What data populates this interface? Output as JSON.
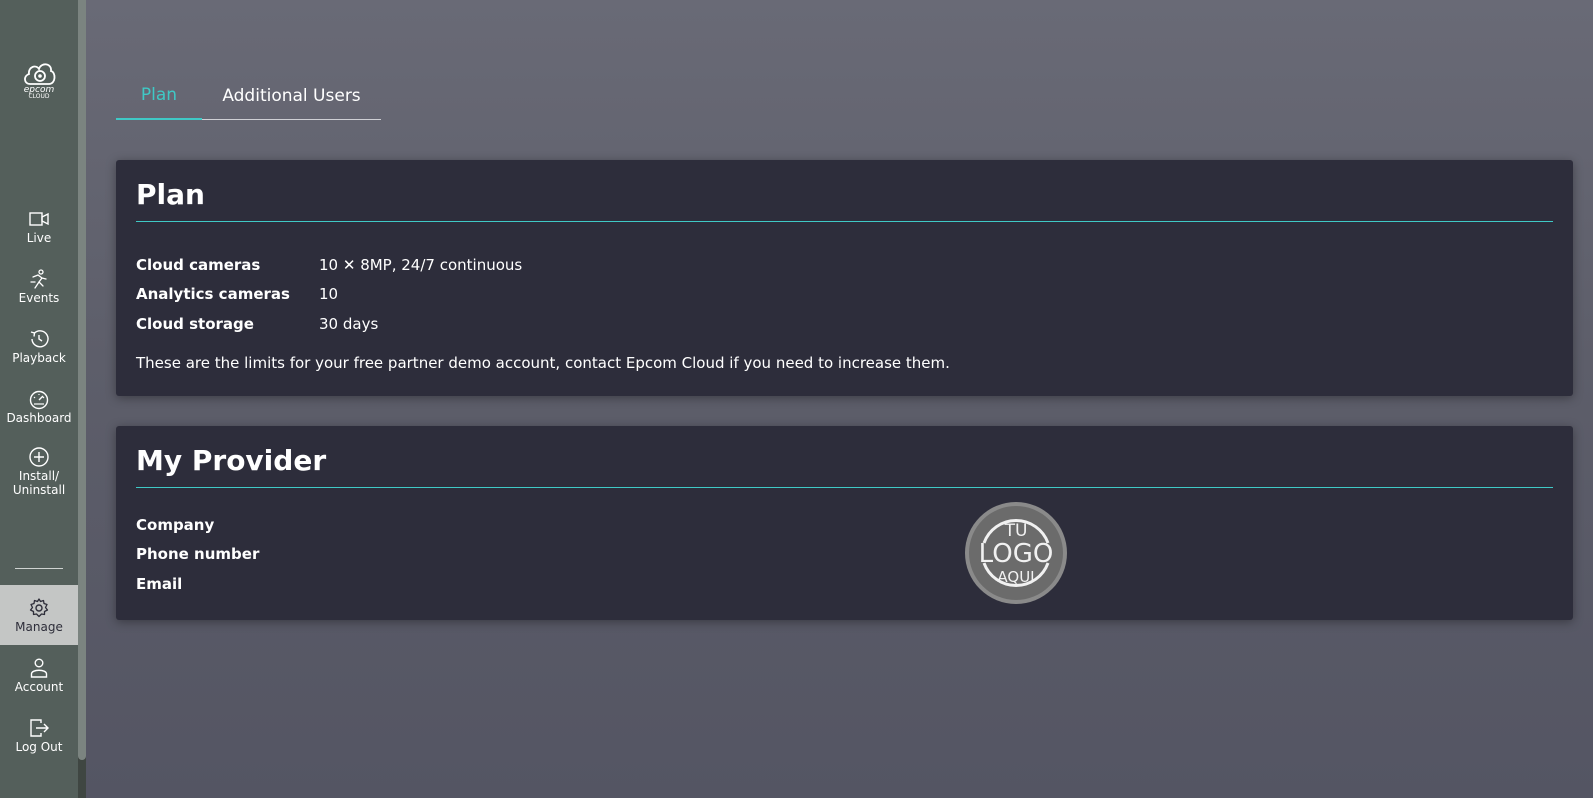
{
  "brand": {
    "name": "epcom",
    "sub": "CLOUD"
  },
  "sidebar": {
    "items": [
      {
        "label": "Live",
        "icon": "camera-icon"
      },
      {
        "label": "Events",
        "icon": "running-person-icon"
      },
      {
        "label": "Playback",
        "icon": "history-icon"
      },
      {
        "label": "Dashboard",
        "icon": "gauge-icon"
      },
      {
        "label_line1": "Install/",
        "label_line2": "Uninstall",
        "icon": "plus-circle-icon"
      }
    ],
    "bottom_items": [
      {
        "label": "Manage",
        "icon": "gear-icon",
        "active": true
      },
      {
        "label": "Account",
        "icon": "user-icon"
      },
      {
        "label": "Log Out",
        "icon": "logout-icon"
      }
    ]
  },
  "tabs": [
    {
      "label": "Plan",
      "active": true
    },
    {
      "label": "Additional Users",
      "active": false
    }
  ],
  "plan": {
    "title": "Plan",
    "rows": [
      {
        "key": "Cloud cameras",
        "value": "10 ✕ 8MP, 24/7 continuous"
      },
      {
        "key": "Analytics cameras",
        "value": "10"
      },
      {
        "key": "Cloud storage",
        "value": "30 days"
      }
    ],
    "note": "These are the limits for your free partner demo account, contact Epcom Cloud if you need to increase them."
  },
  "provider": {
    "title": "My Provider",
    "rows": [
      {
        "key": "Company"
      },
      {
        "key": "Phone number"
      },
      {
        "key": "Email"
      }
    ],
    "logo": {
      "top": "TU",
      "middle": "LOGO",
      "bottom": "AQUI"
    }
  },
  "colors": {
    "accent": "#3fc9c6",
    "sidebar": "#545f5b",
    "card": "#2d2d3b",
    "active_nav": "#c4c6c5"
  }
}
